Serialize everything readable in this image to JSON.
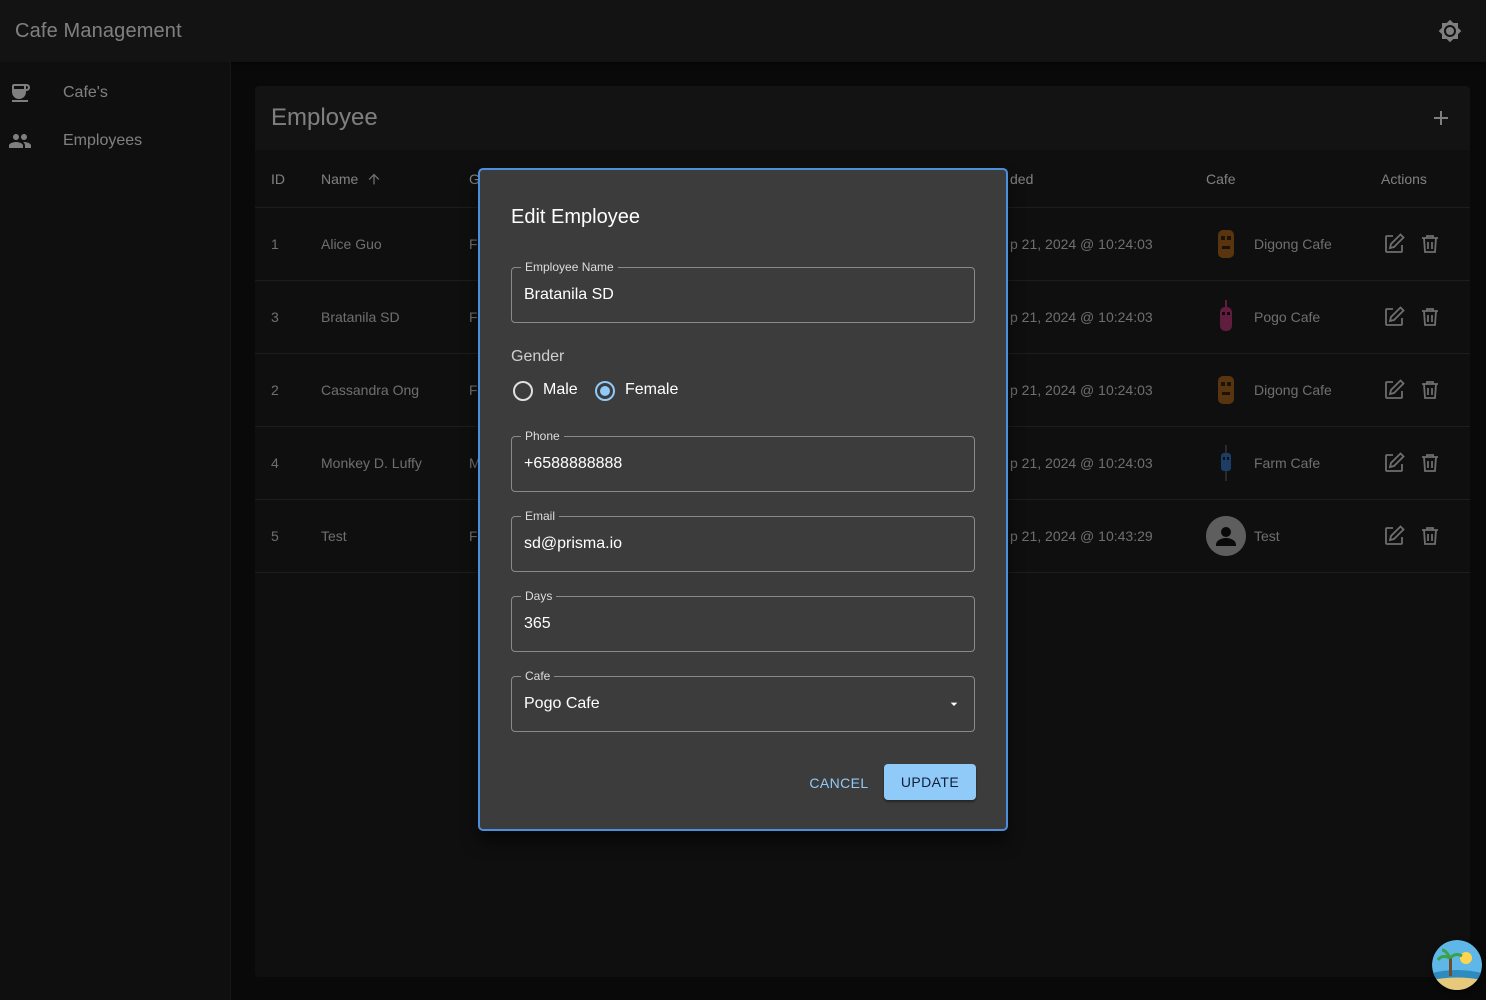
{
  "app": {
    "title": "Cafe Management",
    "theme_icon": "brightness-icon"
  },
  "sidebar": {
    "items": [
      {
        "label": "Cafe's",
        "icon": "coffee-cup-icon"
      },
      {
        "label": "Employees",
        "icon": "people-icon"
      }
    ]
  },
  "panel": {
    "title": "Employee",
    "add_icon": "plus-icon",
    "columns": {
      "id": "ID",
      "name": "Name",
      "gender_partial": "G",
      "start_partial": "ded",
      "cafe": "Cafe",
      "actions": "Actions"
    },
    "rows": [
      {
        "id": "1",
        "name": "Alice Guo",
        "gender": "F",
        "start": "p 21, 2024 @ 10:24:03",
        "cafe": "Digong Cafe",
        "logo": "digong-logo"
      },
      {
        "id": "3",
        "name": "Bratanila SD",
        "gender": "F",
        "start": "p 21, 2024 @ 10:24:03",
        "cafe": "Pogo Cafe",
        "logo": "pogo-logo"
      },
      {
        "id": "2",
        "name": "Cassandra Ong",
        "gender": "F",
        "start": "p 21, 2024 @ 10:24:03",
        "cafe": "Digong Cafe",
        "logo": "digong-logo"
      },
      {
        "id": "4",
        "name": "Monkey D. Luffy",
        "gender": "M",
        "start": "p 21, 2024 @ 10:24:03",
        "cafe": "Farm Cafe",
        "logo": "farm-logo"
      },
      {
        "id": "5",
        "name": "Test",
        "gender": "F",
        "start": "p 21, 2024 @ 10:43:29",
        "cafe": "Test",
        "logo": "default-avatar"
      }
    ]
  },
  "dialog": {
    "title": "Edit Employee",
    "employee_name": {
      "label": "Employee Name",
      "value": "Bratanila SD"
    },
    "gender": {
      "label": "Gender",
      "options": [
        "Male",
        "Female"
      ],
      "selected": "Female"
    },
    "phone": {
      "label": "Phone",
      "value": "+6588888888"
    },
    "email": {
      "label": "Email",
      "value": "sd@prisma.io"
    },
    "days": {
      "label": "Days",
      "value": "365"
    },
    "cafe": {
      "label": "Cafe",
      "value": "Pogo Cafe"
    },
    "cancel_label": "CANCEL",
    "update_label": "UPDATE"
  },
  "colors": {
    "accent": "#90caf9",
    "dialog_border": "#4b8fdc",
    "background": "#121212"
  }
}
